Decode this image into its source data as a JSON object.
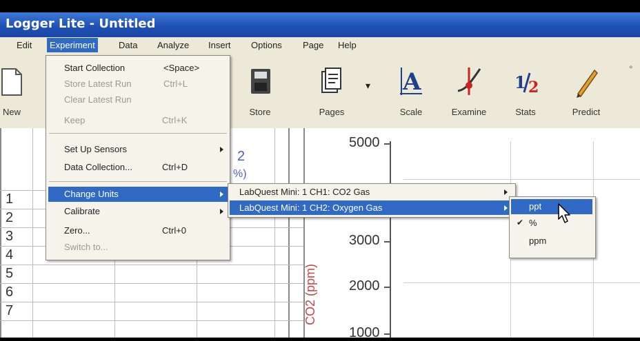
{
  "window": {
    "title": "Logger Lite - Untitled"
  },
  "menubar": [
    "Edit",
    "Experiment",
    "Data",
    "Analyze",
    "Insert",
    "Options",
    "Page",
    "Help"
  ],
  "toolbar": {
    "new": "New",
    "store": "Store",
    "pages": "Pages",
    "scale": "Scale",
    "examine": "Examine",
    "stats": "Stats",
    "predict": "Predict"
  },
  "experiment_menu": {
    "start_collection": "Start Collection",
    "start_collection_shortcut": "<Space>",
    "store_latest_run": "Store Latest Run",
    "store_latest_run_shortcut": "Ctrl+L",
    "clear_latest_run": "Clear Latest Run",
    "keep": "Keep",
    "keep_shortcut": "Ctrl+K",
    "set_up_sensors": "Set Up Sensors",
    "data_collection": "Data Collection...",
    "data_collection_shortcut": "Ctrl+D",
    "change_units": "Change Units",
    "calibrate": "Calibrate",
    "zero": "Zero...",
    "zero_shortcut": "Ctrl+0",
    "switch_to": "Switch to..."
  },
  "units_submenu": {
    "ch1": "LabQuest Mini: 1 CH1: CO2 Gas",
    "ch2": "LabQuest Mini: 1 CH2: Oxygen Gas"
  },
  "oxygen_units": {
    "ppt": "ppt",
    "percent": "%",
    "ppm": "ppm",
    "checked": "✔"
  },
  "table": {
    "rows": [
      "1",
      "2",
      "3",
      "4",
      "5",
      "6",
      "7"
    ],
    "partial_header_a": "2",
    "partial_header_b": "%)"
  },
  "graph": {
    "ylabel": "CO2 (ppm)",
    "ticks": [
      "5000",
      "3000",
      "2000",
      "1000"
    ]
  }
}
